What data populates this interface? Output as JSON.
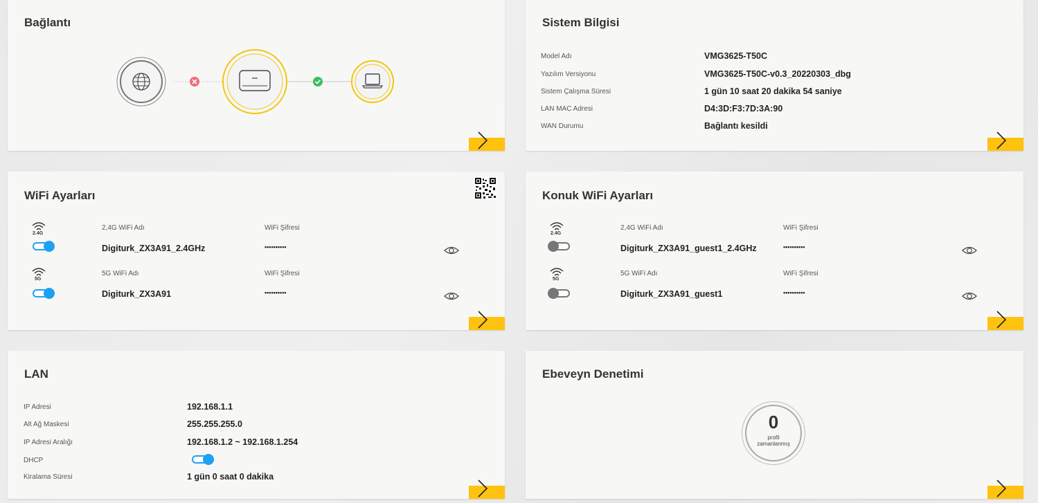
{
  "colors": {
    "accent": "#ffc20e",
    "toggle_on": "#1ea0f3",
    "toggle_off": "#777777",
    "fail": "#f06a7a",
    "ok": "#3dbd5d"
  },
  "connection": {
    "title": "Bağlantı",
    "status_internet": "fail",
    "status_lan": "ok"
  },
  "system": {
    "title": "Sistem Bilgisi",
    "rows": [
      {
        "label": "Model Adı",
        "value": "VMG3625-T50C"
      },
      {
        "label": "Yazılım Versiyonu",
        "value": "VMG3625-T50C-v0.3_20220303_dbg"
      },
      {
        "label": "Sistem Çalışma Süresi",
        "value": "1 gün 10 saat 20 dakika 54 saniye"
      },
      {
        "label": "LAN MAC Adresi",
        "value": "D4:3D:F3:7D:3A:90"
      },
      {
        "label": "WAN Durumu",
        "value": "Bağlantı kesildi"
      }
    ]
  },
  "wifi": {
    "title": "WiFi Ayarları",
    "bands": [
      {
        "band_label": "2.4G",
        "name_label": "2,4G WiFi Adı",
        "ssid": "Digiturk_ZX3A91_2.4GHz",
        "pass_label": "WiFi Şifresi",
        "password": "••••••••••",
        "enabled": true
      },
      {
        "band_label": "5G",
        "name_label": "5G WiFi Adı",
        "ssid": "Digiturk_ZX3A91",
        "pass_label": "WiFi Şifresi",
        "password": "••••••••••",
        "enabled": true
      }
    ]
  },
  "guest": {
    "title": "Konuk WiFi Ayarları",
    "bands": [
      {
        "band_label": "2.4G",
        "name_label": "2,4G WiFi Adı",
        "ssid": "Digiturk_ZX3A91_guest1_2.4GHz",
        "pass_label": "WiFi Şifresi",
        "password": "••••••••••",
        "enabled": false
      },
      {
        "band_label": "5G",
        "name_label": "5G WiFi Adı",
        "ssid": "Digiturk_ZX3A91_guest1",
        "pass_label": "WiFi Şifresi",
        "password": "••••••••••",
        "enabled": false
      }
    ]
  },
  "lan": {
    "title": "LAN",
    "rows": [
      {
        "label": "IP Adresi",
        "value": "192.168.1.1"
      },
      {
        "label": "Alt Ağ Maskesi",
        "value": "255.255.255.0"
      },
      {
        "label": "IP Adresi Aralığı",
        "value": "192.168.1.2 ~ 192.168.1.254"
      },
      {
        "label": "DHCP",
        "value": ""
      },
      {
        "label": "Kiralama Süresi",
        "value": "1 gün 0 saat 0 dakika"
      }
    ],
    "dhcp_enabled": true
  },
  "parental": {
    "title": "Ebeveyn Denetimi",
    "count": "0",
    "count_label_1": "profil",
    "count_label_2": "zamanlanmış"
  }
}
